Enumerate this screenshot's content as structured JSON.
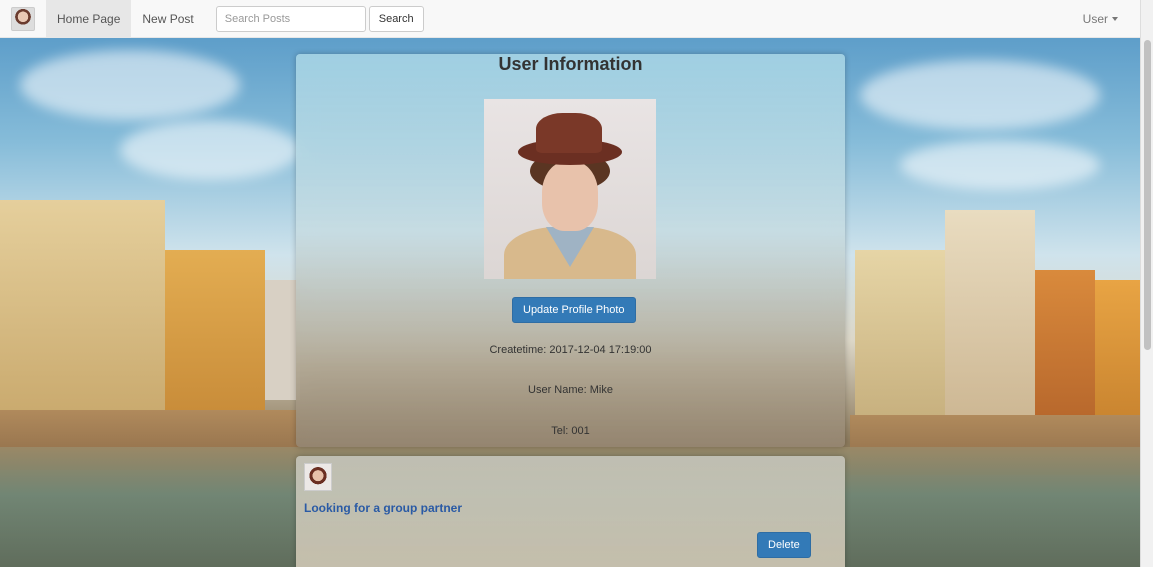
{
  "navbar": {
    "home_label": "Home Page",
    "new_post_label": "New Post",
    "search_placeholder": "Search Posts",
    "search_button": "Search",
    "user_menu_label": "User"
  },
  "profile": {
    "title": "User Information",
    "update_photo_button": "Update Profile Photo",
    "createtime": "Createtime: 2017-12-04 17:19:00",
    "username": "User Name: Mike",
    "tel": "Tel: 001"
  },
  "posts": [
    {
      "title": "Looking for a group partner",
      "delete_label": "Delete"
    }
  ],
  "colors": {
    "primary": "#337ab7",
    "link": "#2a5aa5",
    "navbar_bg": "#f8f8f8"
  }
}
